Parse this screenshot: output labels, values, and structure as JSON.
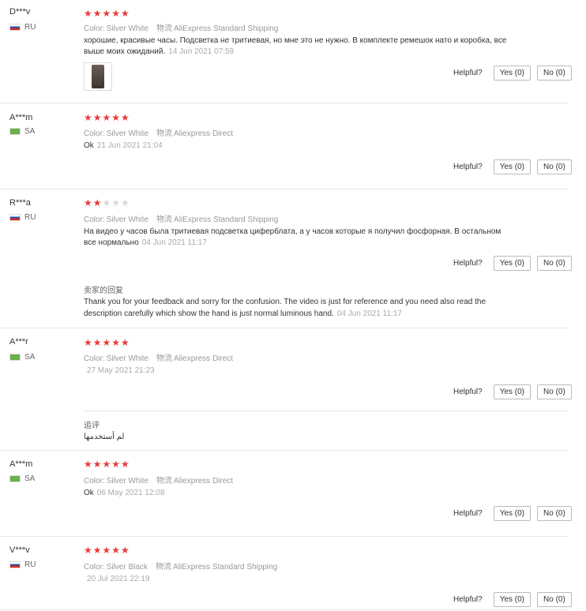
{
  "helpful_label": "Helpful?",
  "color_label": "Color:",
  "shipping_label": "物流",
  "reviews": [
    {
      "user": "D***v",
      "country": "RU",
      "rating": 5,
      "color": "Silver White",
      "shipping": "AliExpress Standard Shipping",
      "text": "хорошие, красивые часы. Подсветка не тритиевая, но мне это не нужно. В комплекте ремешок нато и коробка, все выше моих ожиданий.",
      "date": "14 Jun 2021 07:59",
      "yes": "Yes (0)",
      "no": "No (0)"
    },
    {
      "user": "A***m",
      "country": "SA",
      "rating": 5,
      "color": "Silver White",
      "shipping": "Aliexpress Direct",
      "text": "Ok",
      "date": "21 Jun 2021 21:04",
      "yes": "Yes (0)",
      "no": "No (0)"
    },
    {
      "user": "R***a",
      "country": "RU",
      "rating": 2,
      "color": "Silver White",
      "shipping": "AliExpress Standard Shipping",
      "text": "На видео у часов была тритиевая подсветка циферблата, а у часов которые я получил фосфорная. В остальном все нормально",
      "date": "04 Jun 2021 11:17",
      "yes": "Yes (0)",
      "no": "No (0)",
      "reply_title": "卖家的回复",
      "reply_text": "Thank you for your feedback and sorry for the confusion. The video is just for reference and you need also read the description carefully which show the hand is just normal luminous hand.",
      "reply_date": "04 Jun 2021 11:17"
    },
    {
      "user": "A***r",
      "country": "SA",
      "rating": 5,
      "color": "Silver White",
      "shipping": "Aliexpress Direct",
      "text": "",
      "date": "27 May 2021 21:23",
      "yes": "Yes (0)",
      "no": "No (0)",
      "followup_title": "追评",
      "followup_text": "لم أستخدمها"
    },
    {
      "user": "A***m",
      "country": "SA",
      "rating": 5,
      "color": "Silver White",
      "shipping": "Aliexpress Direct",
      "text": "Ok",
      "date": "06 May 2021 12:08",
      "yes": "Yes (0)",
      "no": "No (0)"
    },
    {
      "user": "V***v",
      "country": "RU",
      "rating": 5,
      "color": "Silver Black",
      "shipping": "AliExpress Standard Shipping",
      "text": "",
      "date": "20 Jul 2021 22:19",
      "yes": "Yes (0)",
      "no": "No (0)"
    }
  ]
}
